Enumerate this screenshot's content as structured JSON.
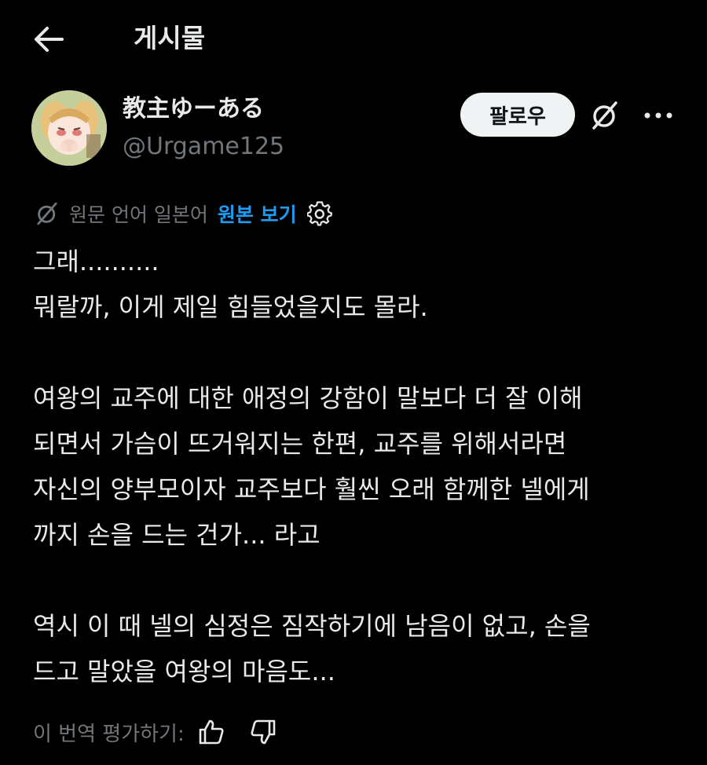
{
  "header": {
    "title": "게시물",
    "back_icon": "arrow-left-icon"
  },
  "author": {
    "display_name": "教主ゆーある",
    "handle": "@Urgame125",
    "follow_label": "팔로우"
  },
  "translation": {
    "label": "원문 언어 일본어",
    "view_original": "원본 보기"
  },
  "post": {
    "paragraphs": [
      "그래..........\n뭐랄까, 이게 제일 힘들었을지도 몰라.",
      "여왕의 교주에 대한 애정의 강함이 말보다 더 잘 이해\n되면서 가슴이 뜨거워지는 한편, 교주를 위해서라면\n자신의 양부모이자 교주보다 훨씬 오래 함께한 넬에게\n까지 손을 드는 건가... 라고",
      "역시 이 때 넬의 심정은 짐작하기에 남음이 없고, 손을\n드고 말았을 여왕의 마음도..."
    ]
  },
  "rating": {
    "label": "이 번역 평가하기:"
  },
  "colors": {
    "background": "#000000",
    "text": "#e7e9ea",
    "muted": "#71767b",
    "accent": "#1d9bf0",
    "follow_bg": "#eff3f4"
  }
}
